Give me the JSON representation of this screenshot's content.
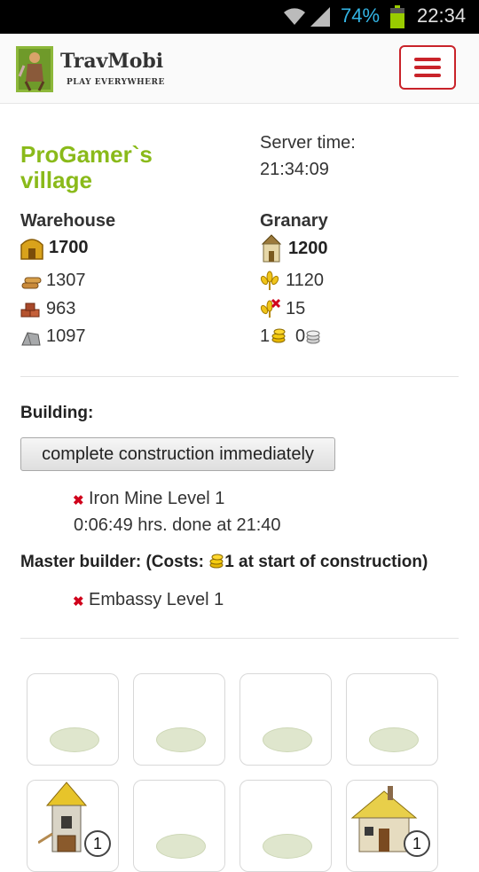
{
  "status_bar": {
    "battery_percent": "74%",
    "clock": "22:34",
    "battery_level": 0.74,
    "icons": [
      "wifi-icon",
      "signal-icon",
      "battery-icon"
    ]
  },
  "header": {
    "brand": "TravMobi",
    "tagline": "PLAY EVERYWHERE",
    "menu_icon": "hamburger-icon",
    "accent_color": "#c9232a"
  },
  "village": {
    "name": "ProGamer`s village",
    "name_color": "#8aba1a",
    "server_time_label": "Server time:",
    "server_time": "21:34:09"
  },
  "warehouse": {
    "title": "Warehouse",
    "capacity": "1700",
    "wood": "1307",
    "clay": "963",
    "iron": "1097"
  },
  "granary": {
    "title": "Granary",
    "capacity": "1200",
    "crop": "1120",
    "crop_consumption": "15",
    "gold": "1",
    "silver": "0"
  },
  "building": {
    "label": "Building:",
    "complete_button": "complete construction immediately",
    "queue": [
      {
        "name": "Iron Mine Level 1",
        "time": "0:06:49 hrs. done at 21:40"
      }
    ],
    "master_builder_label_prefix": "Master builder: (Costs: ",
    "master_builder_label_suffix": "1 at start of construction)",
    "master_queue": [
      {
        "name": "Embassy Level 1"
      }
    ]
  },
  "slots": [
    {
      "type": "empty"
    },
    {
      "type": "empty"
    },
    {
      "type": "empty"
    },
    {
      "type": "empty"
    },
    {
      "type": "building",
      "icon": "tower-building-icon",
      "level": "1"
    },
    {
      "type": "empty"
    },
    {
      "type": "empty"
    },
    {
      "type": "building",
      "icon": "house-building-icon",
      "level": "1"
    }
  ]
}
